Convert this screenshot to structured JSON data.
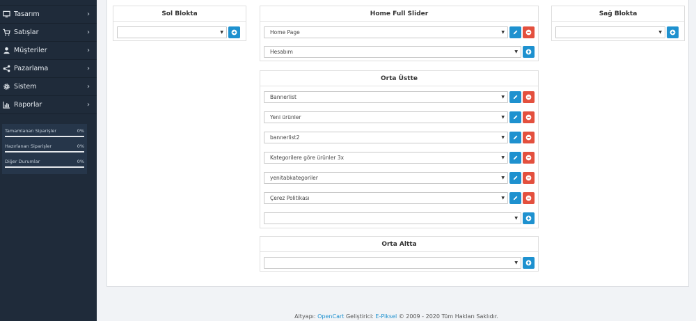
{
  "sidebar": {
    "items": [
      {
        "label": "Tasarım",
        "icon": "monitor-icon"
      },
      {
        "label": "Satışlar",
        "icon": "shopping-cart-icon"
      },
      {
        "label": "Müşteriler",
        "icon": "user-icon"
      },
      {
        "label": "Pazarlama",
        "icon": "share-icon"
      },
      {
        "label": "Sistem",
        "icon": "gear-icon"
      },
      {
        "label": "Raporlar",
        "icon": "bar-chart-icon"
      }
    ],
    "chevron": "›",
    "stats": [
      {
        "label": "Tamamlanan Siparişler",
        "value": "0%",
        "progress": 0
      },
      {
        "label": "Hazırlanan Siparişler",
        "value": "0%",
        "progress": 0
      },
      {
        "label": "Diğer Durumlar",
        "value": "0%",
        "progress": 0
      }
    ]
  },
  "layout": {
    "left": {
      "title": "Sol Blokta",
      "add_select": ""
    },
    "home_slider": {
      "title": "Home Full Slider",
      "modules": [
        "Home Page"
      ],
      "add_select": "Hesabım"
    },
    "right": {
      "title": "Sağ Blokta",
      "add_select": ""
    },
    "content_top": {
      "title": "Orta Üstte",
      "modules": [
        "Bannerlist",
        "Yeni ürünler",
        "bannerlist2",
        "Kategorilere göre ürünler 3x",
        "yenitabkategoriler",
        "Çerez Politikası"
      ],
      "add_select": ""
    },
    "content_bottom": {
      "title": "Orta Altta",
      "add_select": ""
    }
  },
  "footer": {
    "prefix": "Altyapı: ",
    "opencart": "OpenCart",
    "middle": " Geliştirici: ",
    "epiksel": "E-Piksel",
    "suffix": " © 2009 - 2020 Tüm Hakları Saklıdır."
  },
  "colors": {
    "sidebar_bg": "#1f2b3a",
    "primary": "#1e91cf",
    "danger": "#e3503e"
  }
}
